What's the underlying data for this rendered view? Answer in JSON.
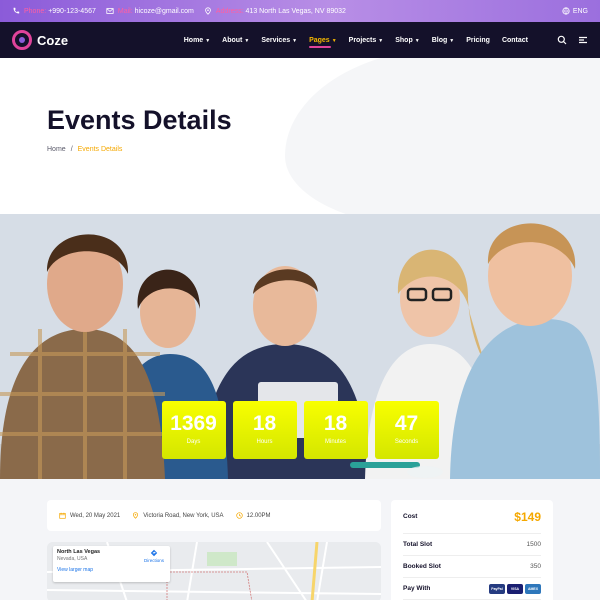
{
  "topbar": {
    "phone_label": "Phone:",
    "phone": "+990-123-4567",
    "mail_label": "Mail:",
    "mail": "hicoze@gmail.com",
    "address_label": "Address:",
    "address": "413 North Las Vegas, NV 89032",
    "language": "ENG"
  },
  "nav": {
    "logo": "Coze",
    "items": [
      {
        "label": "Home"
      },
      {
        "label": "About"
      },
      {
        "label": "Services"
      },
      {
        "label": "Pages"
      },
      {
        "label": "Projects"
      },
      {
        "label": "Shop"
      },
      {
        "label": "Blog"
      },
      {
        "label": "Pricing"
      },
      {
        "label": "Contact"
      }
    ]
  },
  "hero": {
    "title": "Events Details",
    "breadcrumb": {
      "home": "Home",
      "separator": "/",
      "current": "Events Details"
    }
  },
  "countdown": [
    {
      "value": "1369",
      "unit": "Days"
    },
    {
      "value": "18",
      "unit": "Hours"
    },
    {
      "value": "18",
      "unit": "Minutes"
    },
    {
      "value": "47",
      "unit": "Seconds"
    }
  ],
  "event_meta": {
    "date": "Wed, 20 May 2021",
    "location": "Victoria Road, New York, USA",
    "time": "12.00PM"
  },
  "map": {
    "place": "North Las Vegas",
    "region": "Nevada, USA",
    "directions": "Directions",
    "larger_map": "View larger map"
  },
  "pricing": {
    "cost_label": "Cost",
    "cost": "$149",
    "total_label": "Total Slot",
    "total": "1500",
    "booked_label": "Booked Slot",
    "booked": "350",
    "pay_label": "Pay With",
    "pay_methods": [
      "PayPal",
      "VISA",
      "AMEX"
    ]
  },
  "colors": {
    "accent_pink": "#e0439b",
    "accent_yellow": "#f5a800",
    "nav_bg": "#14112a",
    "countdown_yellow": "#f8ff00"
  }
}
